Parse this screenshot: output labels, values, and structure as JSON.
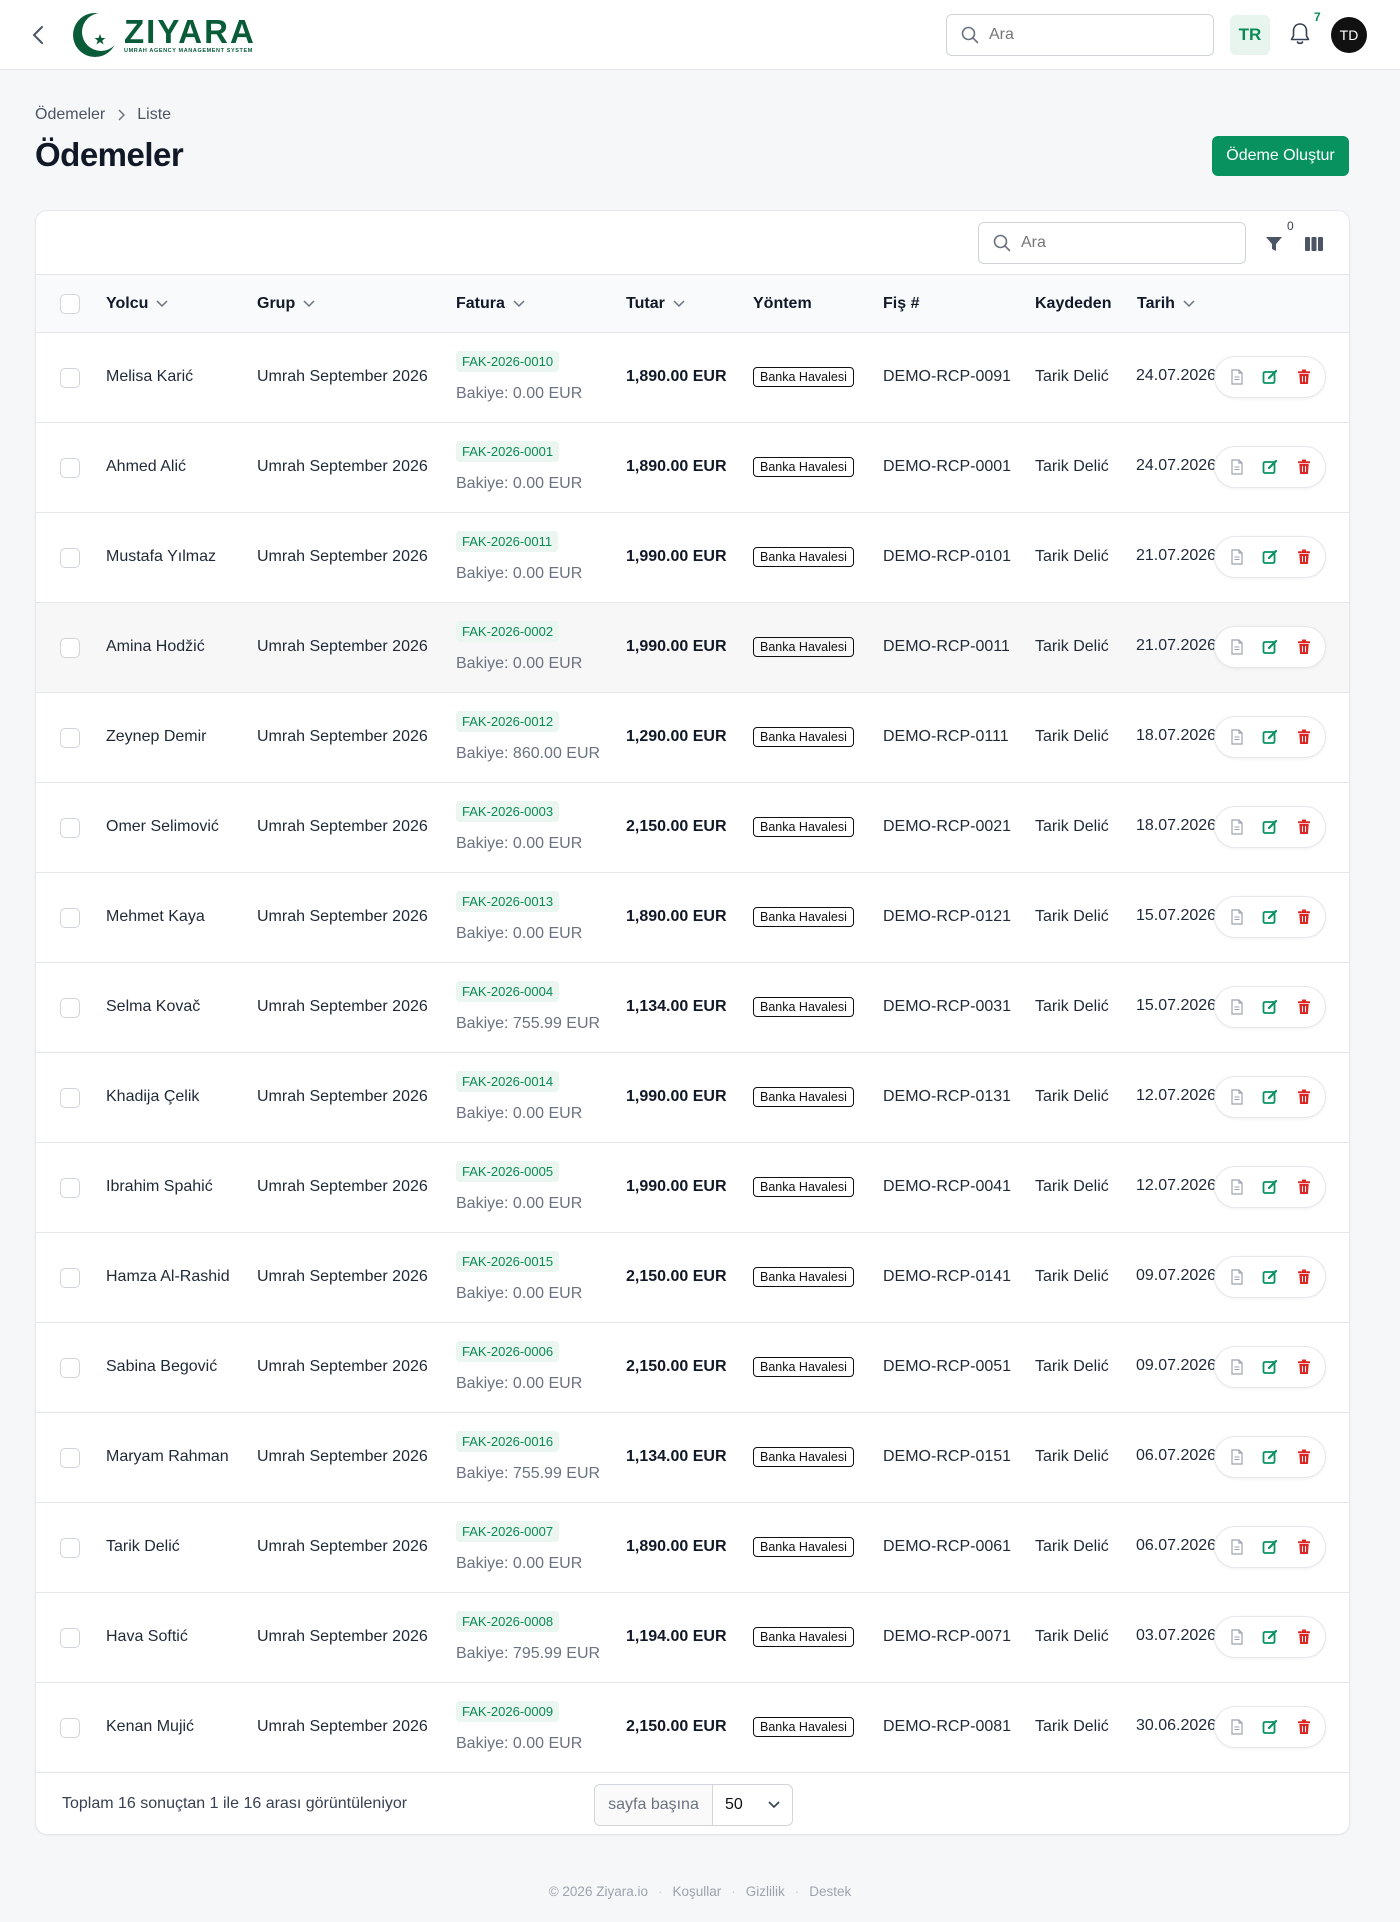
{
  "app": {
    "logo_name": "ZIYARA",
    "logo_subtitle": "UMRAH AGENCY MANAGEMENT SYSTEM",
    "search_placeholder": "Ara",
    "language": "TR",
    "notification_count": "7",
    "user_initials": "TD",
    "brand_color": "#079260"
  },
  "breadcrumb": {
    "parent": "Ödemeler",
    "current": "Liste"
  },
  "page": {
    "title": "Ödemeler",
    "create_button": "Ödeme Oluştur"
  },
  "table": {
    "search_placeholder": "Ara",
    "filter_count": "0",
    "columns": {
      "passenger": "Yolcu",
      "group": "Grup",
      "invoice": "Fatura",
      "amount": "Tutar",
      "method": "Yöntem",
      "receipt": "Fiş #",
      "recorded_by": "Kaydeden",
      "date": "Tarih"
    },
    "rows": [
      {
        "passenger": "Melisa Karić",
        "group": "Umrah September 2026",
        "invoice": "FAK-2026-0010",
        "balance": "Bakiye: 0.00 EUR",
        "amount": "1,890.00 EUR",
        "method": "Banka Havalesi",
        "receipt": "DEMO-RCP-0091",
        "recorded_by": "Tarik Delić",
        "date": "24.07.2026"
      },
      {
        "passenger": "Ahmed Alić",
        "group": "Umrah September 2026",
        "invoice": "FAK-2026-0001",
        "balance": "Bakiye: 0.00 EUR",
        "amount": "1,890.00 EUR",
        "method": "Banka Havalesi",
        "receipt": "DEMO-RCP-0001",
        "recorded_by": "Tarik Delić",
        "date": "24.07.2026"
      },
      {
        "passenger": "Mustafa Yılmaz",
        "group": "Umrah September 2026",
        "invoice": "FAK-2026-0011",
        "balance": "Bakiye: 0.00 EUR",
        "amount": "1,990.00 EUR",
        "method": "Banka Havalesi",
        "receipt": "DEMO-RCP-0101",
        "recorded_by": "Tarik Delić",
        "date": "21.07.2026"
      },
      {
        "passenger": "Amina Hodžić",
        "group": "Umrah September 2026",
        "invoice": "FAK-2026-0002",
        "balance": "Bakiye: 0.00 EUR",
        "amount": "1,990.00 EUR",
        "method": "Banka Havalesi",
        "receipt": "DEMO-RCP-0011",
        "recorded_by": "Tarik Delić",
        "date": "21.07.2026"
      },
      {
        "passenger": "Zeynep Demir",
        "group": "Umrah September 2026",
        "invoice": "FAK-2026-0012",
        "balance": "Bakiye: 860.00 EUR",
        "amount": "1,290.00 EUR",
        "method": "Banka Havalesi",
        "receipt": "DEMO-RCP-0111",
        "recorded_by": "Tarik Delić",
        "date": "18.07.2026"
      },
      {
        "passenger": "Omer Selimović",
        "group": "Umrah September 2026",
        "invoice": "FAK-2026-0003",
        "balance": "Bakiye: 0.00 EUR",
        "amount": "2,150.00 EUR",
        "method": "Banka Havalesi",
        "receipt": "DEMO-RCP-0021",
        "recorded_by": "Tarik Delić",
        "date": "18.07.2026"
      },
      {
        "passenger": "Mehmet Kaya",
        "group": "Umrah September 2026",
        "invoice": "FAK-2026-0013",
        "balance": "Bakiye: 0.00 EUR",
        "amount": "1,890.00 EUR",
        "method": "Banka Havalesi",
        "receipt": "DEMO-RCP-0121",
        "recorded_by": "Tarik Delić",
        "date": "15.07.2026"
      },
      {
        "passenger": "Selma Kovač",
        "group": "Umrah September 2026",
        "invoice": "FAK-2026-0004",
        "balance": "Bakiye: 755.99 EUR",
        "amount": "1,134.00 EUR",
        "method": "Banka Havalesi",
        "receipt": "DEMO-RCP-0031",
        "recorded_by": "Tarik Delić",
        "date": "15.07.2026"
      },
      {
        "passenger": "Khadija Çelik",
        "group": "Umrah September 2026",
        "invoice": "FAK-2026-0014",
        "balance": "Bakiye: 0.00 EUR",
        "amount": "1,990.00 EUR",
        "method": "Banka Havalesi",
        "receipt": "DEMO-RCP-0131",
        "recorded_by": "Tarik Delić",
        "date": "12.07.2026"
      },
      {
        "passenger": "Ibrahim Spahić",
        "group": "Umrah September 2026",
        "invoice": "FAK-2026-0005",
        "balance": "Bakiye: 0.00 EUR",
        "amount": "1,990.00 EUR",
        "method": "Banka Havalesi",
        "receipt": "DEMO-RCP-0041",
        "recorded_by": "Tarik Delić",
        "date": "12.07.2026"
      },
      {
        "passenger": "Hamza Al-Rashid",
        "group": "Umrah September 2026",
        "invoice": "FAK-2026-0015",
        "balance": "Bakiye: 0.00 EUR",
        "amount": "2,150.00 EUR",
        "method": "Banka Havalesi",
        "receipt": "DEMO-RCP-0141",
        "recorded_by": "Tarik Delić",
        "date": "09.07.2026"
      },
      {
        "passenger": "Sabina Begović",
        "group": "Umrah September 2026",
        "invoice": "FAK-2026-0006",
        "balance": "Bakiye: 0.00 EUR",
        "amount": "2,150.00 EUR",
        "method": "Banka Havalesi",
        "receipt": "DEMO-RCP-0051",
        "recorded_by": "Tarik Delić",
        "date": "09.07.2026"
      },
      {
        "passenger": "Maryam Rahman",
        "group": "Umrah September 2026",
        "invoice": "FAK-2026-0016",
        "balance": "Bakiye: 755.99 EUR",
        "amount": "1,134.00 EUR",
        "method": "Banka Havalesi",
        "receipt": "DEMO-RCP-0151",
        "recorded_by": "Tarik Delić",
        "date": "06.07.2026"
      },
      {
        "passenger": "Tarik Delić",
        "group": "Umrah September 2026",
        "invoice": "FAK-2026-0007",
        "balance": "Bakiye: 0.00 EUR",
        "amount": "1,890.00 EUR",
        "method": "Banka Havalesi",
        "receipt": "DEMO-RCP-0061",
        "recorded_by": "Tarik Delić",
        "date": "06.07.2026"
      },
      {
        "passenger": "Hava Softić",
        "group": "Umrah September 2026",
        "invoice": "FAK-2026-0008",
        "balance": "Bakiye: 795.99 EUR",
        "amount": "1,194.00 EUR",
        "method": "Banka Havalesi",
        "receipt": "DEMO-RCP-0071",
        "recorded_by": "Tarik Delić",
        "date": "03.07.2026"
      },
      {
        "passenger": "Kenan Mujić",
        "group": "Umrah September 2026",
        "invoice": "FAK-2026-0009",
        "balance": "Bakiye: 0.00 EUR",
        "amount": "2,150.00 EUR",
        "method": "Banka Havalesi",
        "receipt": "DEMO-RCP-0081",
        "recorded_by": "Tarik Delić",
        "date": "30.06.2026"
      }
    ],
    "summary": "Toplam 16 sonuçtan 1 ile 16 arası görüntüleniyor",
    "per_page_label": "sayfa başına",
    "per_page_value": "50"
  },
  "footer": {
    "copyright": "© 2026 Ziyara.io",
    "terms": "Koşullar",
    "privacy": "Gizlilik",
    "support": "Destek"
  }
}
